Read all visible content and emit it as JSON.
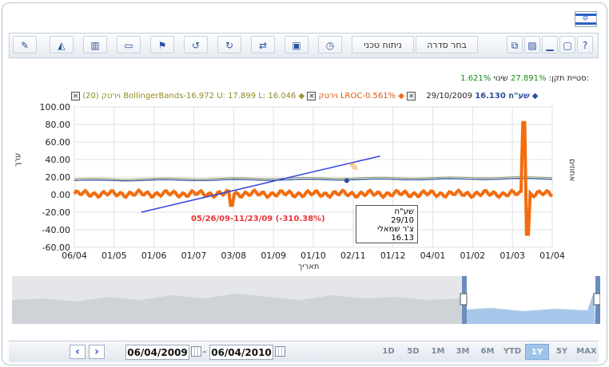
{
  "toolbar": {
    "series_button": "בחר סדרה",
    "technical_button": "ניתוח טכני",
    "icons": [
      "edit-icon",
      "area-chart-icon",
      "bar-chart-icon",
      "comment-icon",
      "flag-icon",
      "undo-icon",
      "redo-icon",
      "refresh-icon",
      "export-icon",
      "clock-icon"
    ],
    "window_icons": [
      "help-icon",
      "maximize-icon",
      "minimize-icon",
      "image-icon",
      "tile-icon"
    ]
  },
  "stats": {
    "change_label": "שינוי:",
    "change_value": "27.891%",
    "deviation_label": "סטיית תקן:",
    "deviation_value": "1.621%"
  },
  "legend": {
    "date": "29/10/2009",
    "main_series": "שע\"ח 16.130",
    "lroc": "וירטק LROC-0.561%",
    "bollinger": "וירטק (20) BollingerBands-16.972 U: 17.899 L: 16.046"
  },
  "axis": {
    "xlabel": "תאריך",
    "ylabel": "ערך",
    "right_label": "אחוזים"
  },
  "tooltip": {
    "title": "שע\"ח",
    "date": "29/10",
    "text": "צ'ר שמאלי 16.13"
  },
  "annotation": "05/26/09-11/23/09 (-310.38%)",
  "nav": {
    "prev": "‹",
    "next": "›",
    "from_date": "06/04/2009",
    "separator": "-",
    "to_date": "06/04/2010"
  },
  "ranges": [
    "1D",
    "5D",
    "1M",
    "3M",
    "6M",
    "YTD",
    "1Y",
    "5Y",
    "MAX"
  ],
  "active_range": "1Y",
  "chart_data": {
    "type": "line",
    "xlabel": "תאריך",
    "ylabel": "ערך",
    "ylim": [
      -60,
      100
    ],
    "yticks": [
      "100.00",
      "80.00",
      "60.00",
      "40.00",
      "20.00",
      "0.00",
      "-20.00",
      "-40.00",
      "-60.00"
    ],
    "xticks": [
      "06/04",
      "01/05",
      "01/06",
      "01/07",
      "03/08",
      "01/09",
      "01/10",
      "02/11",
      "01/12",
      "04/01",
      "01/02",
      "01/03",
      "01/04"
    ],
    "series": [
      {
        "name": "LROC",
        "color": "#f26c0d"
      },
      {
        "name": "BollingerBands",
        "color": "#b3ae3d"
      },
      {
        "name": "שע\"ח",
        "color": "#2a4f9c"
      }
    ]
  }
}
